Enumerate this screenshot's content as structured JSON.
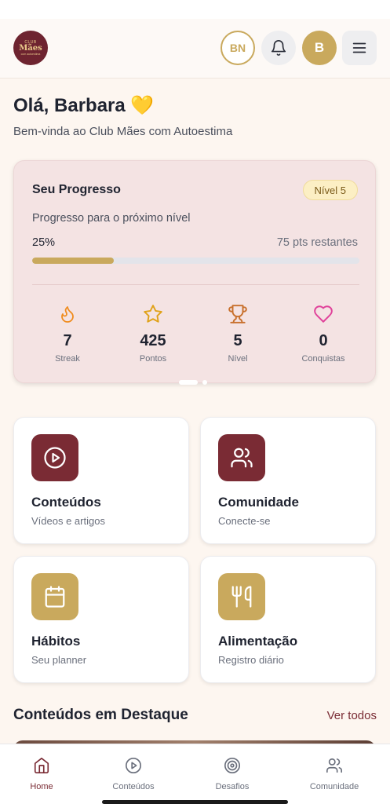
{
  "header": {
    "logo": {
      "top": "CLUB",
      "main": "Mães",
      "sub": "com autoestima"
    },
    "avatar_bn": "BN",
    "avatar_b": "B",
    "icons": {
      "notifications": "bell-icon",
      "menu": "hamburger-icon"
    }
  },
  "greeting": {
    "title": "Olá, Barbara 💛",
    "subtitle": "Bem-vinda ao Club Mães com Autoestima"
  },
  "progress": {
    "title": "Seu Progresso",
    "level_badge": "Nível 5",
    "next_level_label": "Progresso para o próximo nível",
    "percent_label": "25%",
    "percent_value": 25,
    "remaining": "75 pts restantes",
    "stats": [
      {
        "icon": "flame-icon",
        "value": "7",
        "label": "Streak"
      },
      {
        "icon": "star-icon",
        "value": "425",
        "label": "Pontos"
      },
      {
        "icon": "trophy-icon",
        "value": "5",
        "label": "Nível"
      },
      {
        "icon": "heart-icon",
        "value": "0",
        "label": "Conquistas"
      }
    ],
    "carousel_pages": 2,
    "carousel_active": 0
  },
  "tiles": [
    {
      "icon": "play-circle-icon",
      "title": "Conteúdos",
      "subtitle": "Vídeos e artigos",
      "color": "#7a2b34"
    },
    {
      "icon": "users-icon",
      "title": "Comunidade",
      "subtitle": "Conecte-se",
      "color": "#7a2b34"
    },
    {
      "icon": "calendar-icon",
      "title": "Hábitos",
      "subtitle": "Seu planner",
      "color": "#c9a95d"
    },
    {
      "icon": "utensils-icon",
      "title": "Alimentação",
      "subtitle": "Registro diário",
      "color": "#c9a95d"
    }
  ],
  "featured": {
    "title": "Conteúdos em Destaque",
    "see_all": "Ver todos"
  },
  "bottom_nav": [
    {
      "icon": "home-icon",
      "label": "Home",
      "active": true
    },
    {
      "icon": "play-circle-icon",
      "label": "Conteúdos",
      "active": false
    },
    {
      "icon": "target-icon",
      "label": "Desafios",
      "active": false
    },
    {
      "icon": "users-icon",
      "label": "Comunidade",
      "active": false
    }
  ],
  "colors": {
    "accent": "#7a2b34",
    "gold": "#c9a95d",
    "background": "#fdf6f0",
    "card_pink": "#f4e3e3"
  }
}
